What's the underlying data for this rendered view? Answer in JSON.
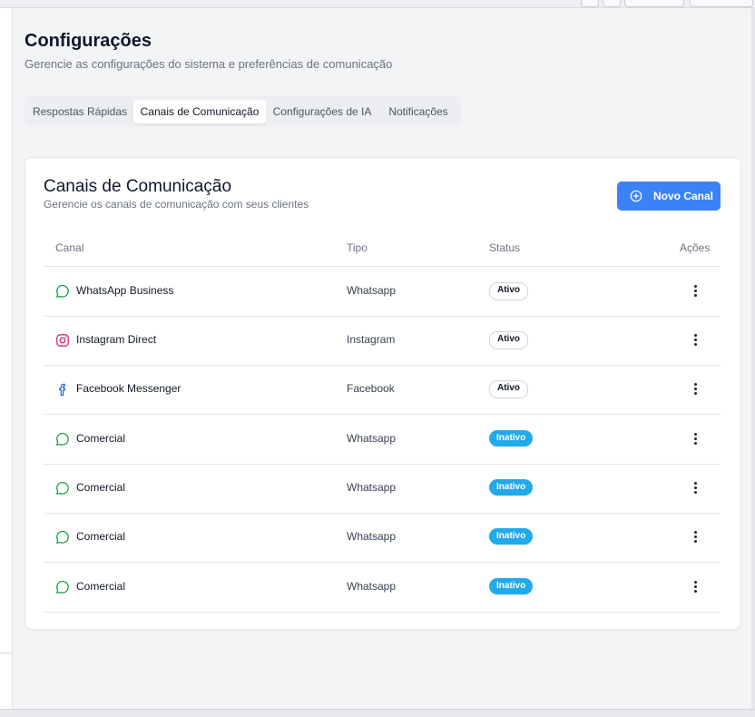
{
  "page": {
    "title": "Configurações",
    "subtitle": "Gerencie as configurações do sistema e preferências de comunicação"
  },
  "tabs": [
    {
      "label": "Respostas Rápidas",
      "active": false
    },
    {
      "label": "Canais de Comunicação",
      "active": true
    },
    {
      "label": "Configurações de IA",
      "active": false
    },
    {
      "label": "Notificações",
      "active": false
    }
  ],
  "card": {
    "title": "Canais de Comunicação",
    "subtitle": "Gerencie os canais de comunicação com seus clientes",
    "new_button": "Novo Canal"
  },
  "table": {
    "columns": [
      "Canal",
      "Tipo",
      "Status",
      "Ações"
    ],
    "rows": [
      {
        "icon": "whatsapp-icon",
        "name": "WhatsApp Business",
        "tipo": "Whatsapp",
        "status": "Ativo"
      },
      {
        "icon": "instagram-icon",
        "name": "Instagram Direct",
        "tipo": "Instagram",
        "status": "Ativo"
      },
      {
        "icon": "facebook-icon",
        "name": "Facebook Messenger",
        "tipo": "Facebook",
        "status": "Ativo"
      },
      {
        "icon": "whatsapp-icon",
        "name": "Comercial",
        "tipo": "Whatsapp",
        "status": "Inativo"
      },
      {
        "icon": "whatsapp-icon",
        "name": "Comercial",
        "tipo": "Whatsapp",
        "status": "Inativo"
      },
      {
        "icon": "whatsapp-icon",
        "name": "Comercial",
        "tipo": "Whatsapp",
        "status": "Inativo"
      },
      {
        "icon": "whatsapp-icon",
        "name": "Comercial",
        "tipo": "Whatsapp",
        "status": "Inativo"
      }
    ]
  },
  "colors": {
    "primary": "#3b82f6",
    "inactive_badge": "#22a9e9",
    "whatsapp": "#16a34a",
    "instagram": "#db2777",
    "facebook": "#2563eb"
  }
}
